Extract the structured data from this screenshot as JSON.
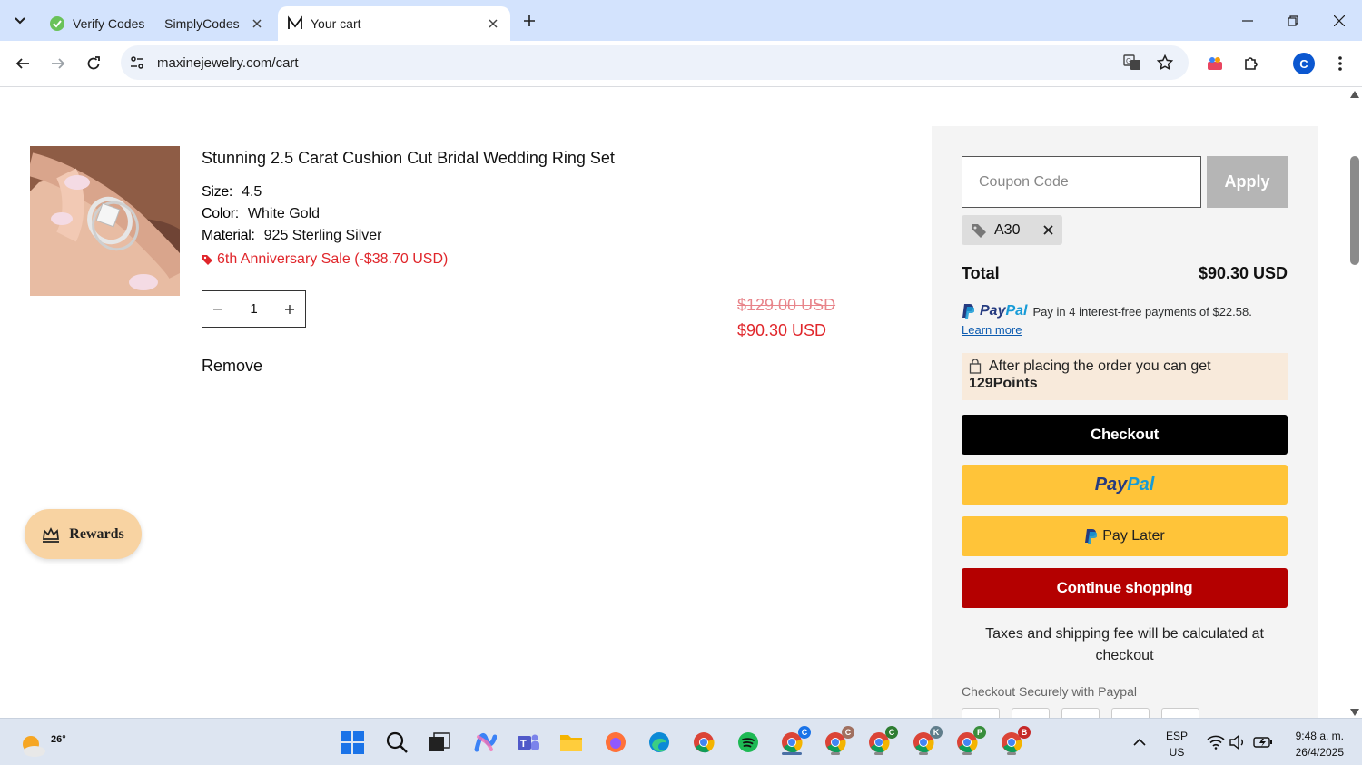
{
  "browser": {
    "tabs": [
      {
        "title": "Verify Codes — SimplyCodes",
        "favicon": "simplycodes-icon",
        "active": false
      },
      {
        "title": "Your cart",
        "favicon": "maxine-m-icon",
        "active": true
      }
    ],
    "url": "maxinejewelry.com/cart",
    "profile_initial": "C"
  },
  "product": {
    "title": "Stunning 2.5 Carat Cushion Cut Bridal Wedding Ring Set",
    "attributes": [
      {
        "label": "Size:",
        "value": "4.5"
      },
      {
        "label": "Color:",
        "value": "White Gold"
      },
      {
        "label": "Material:",
        "value": "925 Sterling Silver"
      }
    ],
    "discount_note": "6th Anniversary Sale (-$38.70 USD)",
    "quantity": "1",
    "price_original": "$129.00 USD",
    "price_final": "$90.30 USD",
    "remove_label": "Remove"
  },
  "rewards_label": "Rewards",
  "summary": {
    "coupon_placeholder": "Coupon Code",
    "apply_label": "Apply",
    "applied_code": "A30",
    "total_label": "Total",
    "total_value": "$90.30 USD",
    "paypal_logo_a": "Pay",
    "paypal_logo_b": "Pal",
    "paypal_message": "Pay in 4 interest-free payments of $22.58.",
    "learn_more": "Learn more",
    "points_text": "After placing the order you can get",
    "points_value": "129Points",
    "checkout_label": "Checkout",
    "paylater_label": "Pay Later",
    "continue_label": "Continue shopping",
    "tax_note": "Taxes and shipping fee will be calculated at checkout",
    "secure_label": "Checkout Securely with Paypal"
  },
  "taskbar": {
    "weather_temp": "26°",
    "lang_line1": "ESP",
    "lang_line2": "US",
    "time": "9:48 a. m.",
    "date": "26/4/2025",
    "chrome_badges": [
      "C",
      "C",
      "C",
      "K",
      "P",
      "B"
    ]
  },
  "colors": {
    "sale_red": "#e0262b",
    "continue_red": "#b40000",
    "paypal_yellow": "#ffc439",
    "paypal_blue": "#253b80"
  }
}
